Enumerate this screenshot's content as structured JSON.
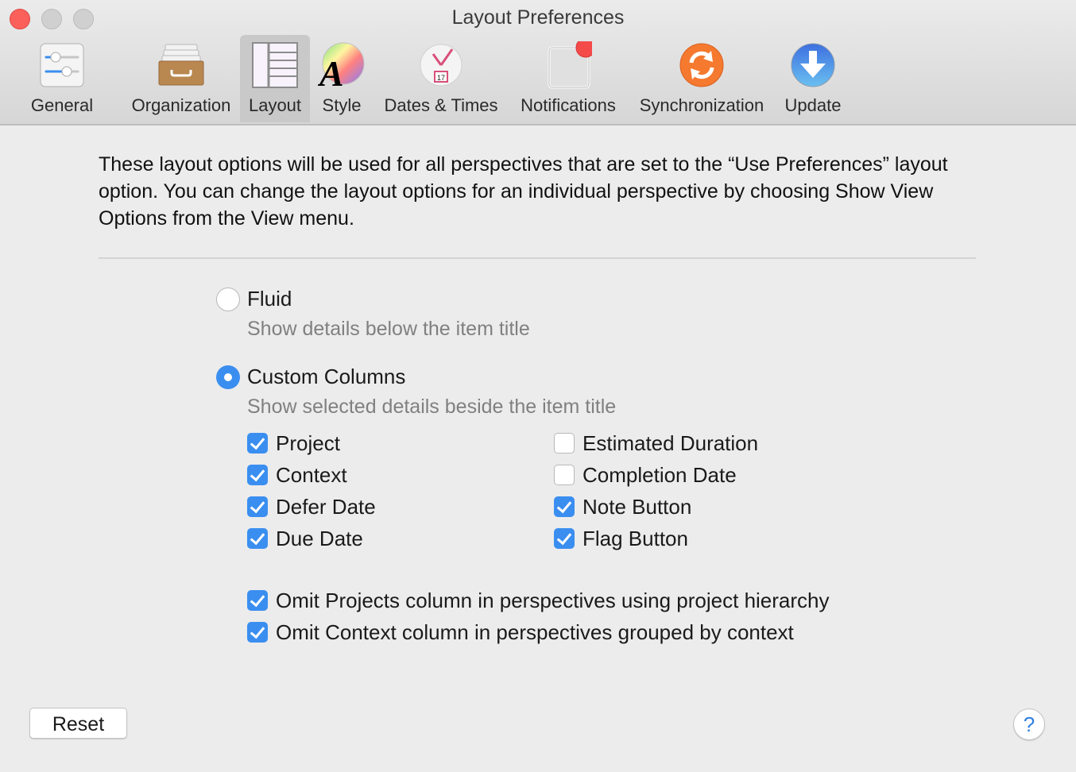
{
  "window": {
    "title": "Layout Preferences"
  },
  "toolbar": {
    "items": [
      {
        "label": "General",
        "icon": "sliders-icon"
      },
      {
        "label": "Organization",
        "icon": "drawer-icon"
      },
      {
        "label": "Layout",
        "icon": "layout-icon",
        "selected": true
      },
      {
        "label": "Style",
        "icon": "color-wheel-font-icon"
      },
      {
        "label": "Dates & Times",
        "icon": "clock-calendar-icon",
        "calendar_day": "17"
      },
      {
        "label": "Notifications",
        "icon": "notification-badge-icon"
      },
      {
        "label": "Synchronization",
        "icon": "sync-icon"
      },
      {
        "label": "Update",
        "icon": "download-arrow-icon"
      }
    ]
  },
  "description": "These layout options will be used for all perspectives that are set to the “Use Preferences” layout option. You can change the layout options for an individual perspective by choosing Show View Options from the View menu.",
  "layout_options": {
    "fluid": {
      "label": "Fluid",
      "sublabel": "Show details below the item title",
      "selected": false
    },
    "custom": {
      "label": "Custom Columns",
      "sublabel": "Show selected details beside the item title",
      "selected": true
    }
  },
  "columns": {
    "left": [
      {
        "label": "Project",
        "checked": true
      },
      {
        "label": "Context",
        "checked": true
      },
      {
        "label": "Defer Date",
        "checked": true
      },
      {
        "label": "Due Date",
        "checked": true
      }
    ],
    "right": [
      {
        "label": "Estimated Duration",
        "checked": false
      },
      {
        "label": "Completion Date",
        "checked": false
      },
      {
        "label": "Note Button",
        "checked": true
      },
      {
        "label": "Flag Button",
        "checked": true
      }
    ]
  },
  "omit_options": [
    {
      "label": "Omit Projects column in perspectives using project hierarchy",
      "checked": true
    },
    {
      "label": "Omit Context column in perspectives grouped by context",
      "checked": true
    }
  ],
  "footer": {
    "reset_label": "Reset",
    "help_label": "?"
  },
  "colors": {
    "accent": "#3a8ef0",
    "close": "#fc605b"
  }
}
